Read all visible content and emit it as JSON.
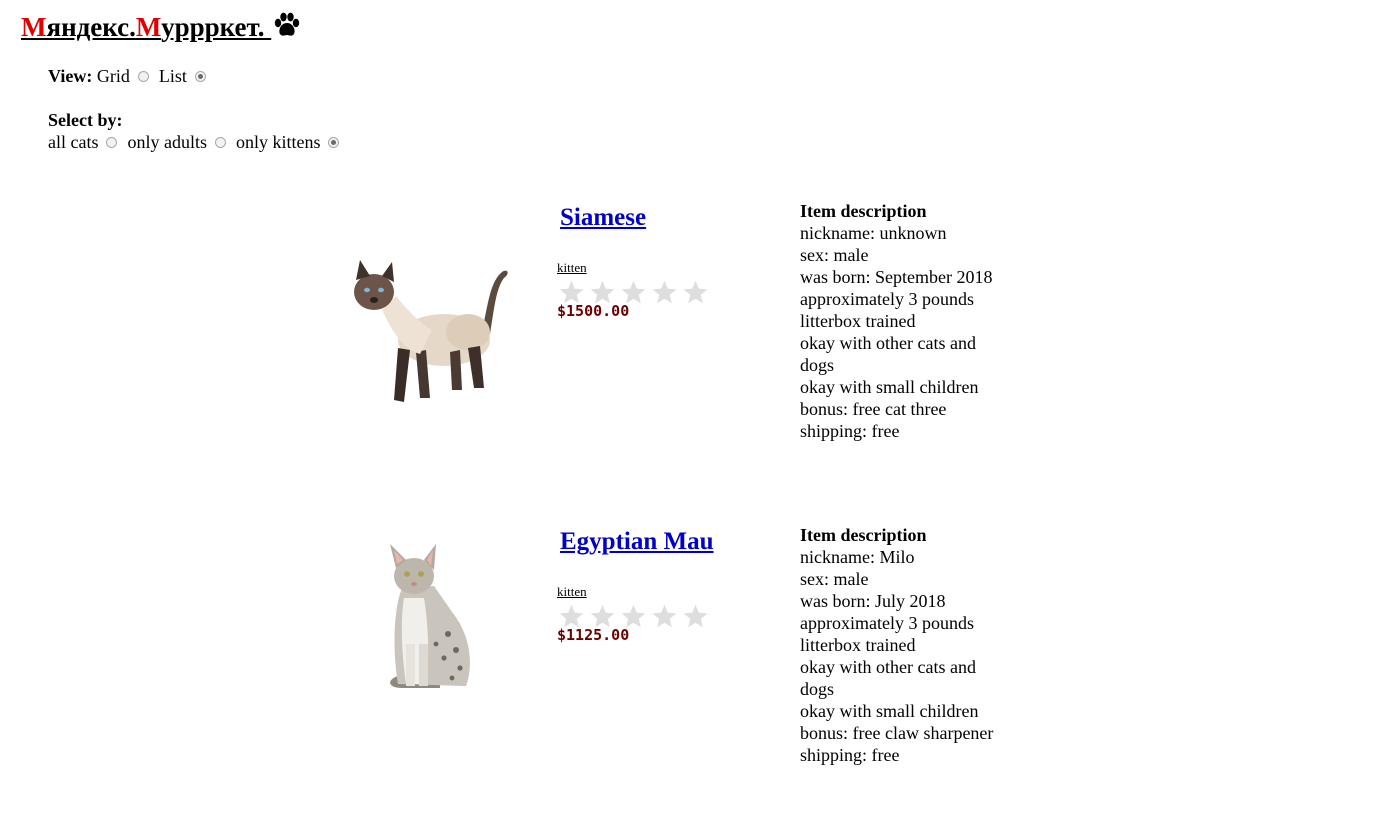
{
  "header": {
    "logo_part1_initial": "М",
    "logo_part1_rest": "яндекс.",
    "logo_part2_initial": "М",
    "logo_part2_rest": "уррркет. "
  },
  "view": {
    "label": "View:",
    "options": [
      {
        "label": "Grid",
        "checked": false
      },
      {
        "label": "List",
        "checked": true
      }
    ]
  },
  "filter": {
    "label": "Select by:",
    "options": [
      {
        "label": "all cats",
        "checked": false
      },
      {
        "label": "only adults",
        "checked": false
      },
      {
        "label": "only kittens",
        "checked": true
      }
    ]
  },
  "items": [
    {
      "title": "Siamese",
      "category": "kitten",
      "rating": 0,
      "price": "$1500.00",
      "desc_heading": "Item description",
      "desc_lines": [
        "nickname: unknown",
        "sex: male",
        "was born: September 2018",
        "approximately 3 pounds",
        "litterbox trained",
        "okay with other cats and dogs",
        "okay with small children",
        "bonus: free cat three",
        "shipping: free"
      ]
    },
    {
      "title": "Egyptian Mau",
      "category": "kitten",
      "rating": 0,
      "price": "$1125.00",
      "desc_heading": "Item description",
      "desc_lines": [
        "nickname: Milo",
        "sex: male",
        "was born: July 2018",
        "approximately 3 pounds",
        "litterbox trained",
        "okay with other cats and dogs",
        "okay with small children",
        "bonus: free claw sharpener",
        "shipping: free"
      ]
    }
  ],
  "colors": {
    "accent_red": "#e00000",
    "link_blue": "#0000c8",
    "price": "#6b0000",
    "star_empty": "#dedede"
  }
}
